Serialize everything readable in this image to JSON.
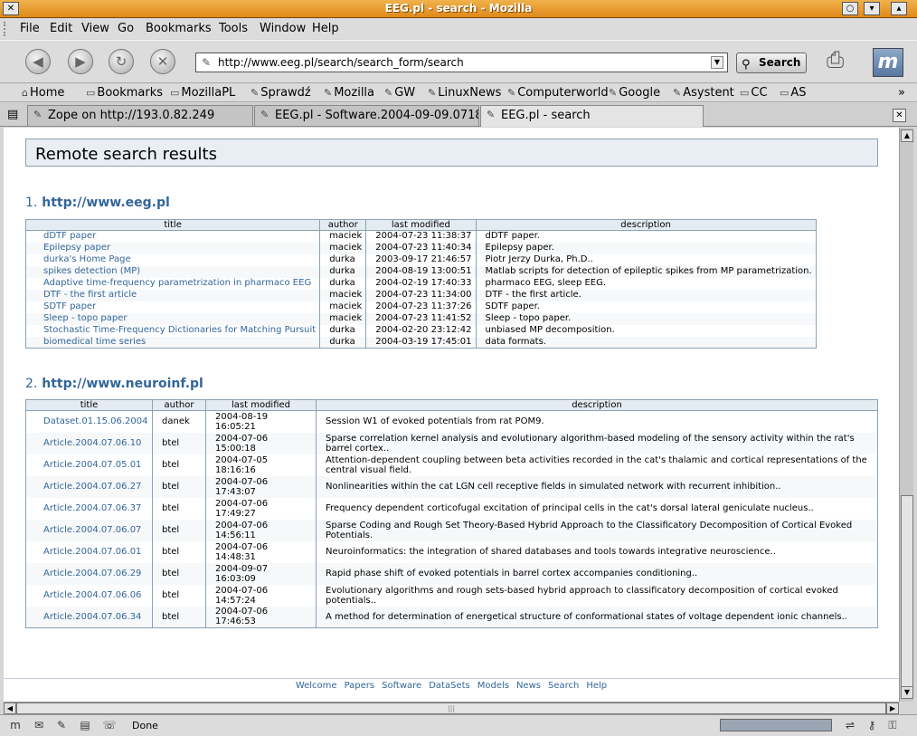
{
  "window": {
    "title": "EEG.pl - search - Mozilla"
  },
  "menubar": [
    "File",
    "Edit",
    "View",
    "Go",
    "Bookmarks",
    "Tools",
    "Window",
    "Help"
  ],
  "navbar": {
    "url": "http://www.eeg.pl/search/search_form/search",
    "search_label": "Search"
  },
  "bookmarks": [
    {
      "label": "Home",
      "icon": "home-icon"
    },
    {
      "label": "Bookmarks",
      "icon": "folder-icon"
    },
    {
      "label": "MozillaPL",
      "icon": "folder-icon"
    },
    {
      "label": "Sprawdź",
      "icon": "bookmark-icon"
    },
    {
      "label": "Mozilla",
      "icon": "bookmark-icon"
    },
    {
      "label": "GW",
      "icon": "bookmark-icon"
    },
    {
      "label": "LinuxNews",
      "icon": "bookmark-icon"
    },
    {
      "label": "Computerworld",
      "icon": "bookmark-icon"
    },
    {
      "label": "Google",
      "icon": "bookmark-icon"
    },
    {
      "label": "Asystent",
      "icon": "bookmark-icon"
    },
    {
      "label": "CC",
      "icon": "folder-icon"
    },
    {
      "label": "AS",
      "icon": "folder-icon"
    }
  ],
  "tabs": [
    {
      "label": "Zope on http://193.0.82.249"
    },
    {
      "label": "EEG.pl - Software.2004-09-09.0718"
    },
    {
      "label": "EEG.pl - search"
    }
  ],
  "page": {
    "heading": "Remote search results",
    "site1": {
      "number": "1.",
      "url": "http://www.eeg.pl",
      "columns": [
        "title",
        "author",
        "last modified",
        "description"
      ],
      "rows": [
        {
          "title": "dDTF paper",
          "author": "maciek",
          "modified": "2004-07-23 11:38:37",
          "description": "dDTF paper."
        },
        {
          "title": "Epilepsy paper",
          "author": "maciek",
          "modified": "2004-07-23 11:40:34",
          "description": "Epilepsy paper."
        },
        {
          "title": "durka's Home Page",
          "author": "durka",
          "modified": "2003-09-17 21:46:57",
          "description": "Piotr Jerzy Durka, Ph.D.."
        },
        {
          "title": "spikes detection (MP)",
          "author": "durka",
          "modified": "2004-08-19 13:00:51",
          "description": "Matlab scripts for detection of epileptic spikes from MP parametrization."
        },
        {
          "title": "Adaptive time-frequency parametrization in pharmaco EEG",
          "author": "durka",
          "modified": "2004-02-19 17:40:33",
          "description": "pharmaco EEG, sleep EEG."
        },
        {
          "title": "DTF - the first article",
          "author": "maciek",
          "modified": "2004-07-23 11:34:00",
          "description": "DTF - the first article."
        },
        {
          "title": "SDTF paper",
          "author": "maciek",
          "modified": "2004-07-23 11:37:26",
          "description": "SDTF paper."
        },
        {
          "title": "Sleep - topo paper",
          "author": "maciek",
          "modified": "2004-07-23 11:41:52",
          "description": "Sleep - topo paper."
        },
        {
          "title": "Stochastic Time-Frequency Dictionaries for Matching Pursuit",
          "author": "durka",
          "modified": "2004-02-20 23:12:42",
          "description": "unbiased MP decomposition."
        },
        {
          "title": "biomedical time series",
          "author": "durka",
          "modified": "2004-03-19 17:45:01",
          "description": "data formats."
        }
      ]
    },
    "site2": {
      "number": "2.",
      "url": "http://www.neuroinf.pl",
      "columns": [
        "title",
        "author",
        "last modified",
        "description"
      ],
      "rows": [
        {
          "title": "Dataset.01.15.06.2004",
          "author": "danek",
          "date": "2004-08-19",
          "time": "16:05:21",
          "description": "Session W1 of evoked potentials from rat POM9."
        },
        {
          "title": "Article.2004.07.06.10",
          "author": "btel",
          "date": "2004-07-06",
          "time": "15:00:18",
          "description": "Sparse correlation kernel analysis and evolutionary algorithm-based modeling of the sensory activity within the rat's barrel cortex.."
        },
        {
          "title": "Article.2004.07.05.01",
          "author": "btel",
          "date": "2004-07-05",
          "time": "18:16:16",
          "description": "Attention-dependent coupling between beta activities recorded in the cat's thalamic and cortical representations of the central visual field."
        },
        {
          "title": "Article.2004.07.06.27",
          "author": "btel",
          "date": "2004-07-06",
          "time": "17:43:07",
          "description": "Nonlinearities within the cat LGN cell receptive fields in simulated network with recurrent inhibition.."
        },
        {
          "title": "Article.2004.07.06.37",
          "author": "btel",
          "date": "2004-07-06",
          "time": "17:49:27",
          "description": "Frequency dependent corticofugal excitation of principal cells in the cat's dorsal lateral geniculate nucleus.."
        },
        {
          "title": "Article.2004.07.06.07",
          "author": "btel",
          "date": "2004-07-06",
          "time": "14:56:11",
          "description": "Sparse Coding and Rough Set Theory-Based Hybrid Approach to the Classificatory Decomposition of Cortical Evoked Potentials."
        },
        {
          "title": "Article.2004.07.06.01",
          "author": "btel",
          "date": "2004-07-06",
          "time": "14:48:31",
          "description": "Neuroinformatics: the integration of shared databases and tools towards integrative neuroscience.."
        },
        {
          "title": "Article.2004.07.06.29",
          "author": "btel",
          "date": "2004-09-07",
          "time": "16:03:09",
          "description": "Rapid phase shift of evoked potentials in barrel cortex accompanies conditioning.."
        },
        {
          "title": "Article.2004.07.06.06",
          "author": "btel",
          "date": "2004-07-06",
          "time": "14:57:24",
          "description": "Evolutionary algorithms and rough sets-based hybrid approach to classificatory decomposition of cortical evoked potentials.."
        },
        {
          "title": "Article.2004.07.06.34",
          "author": "btel",
          "date": "2004-07-06",
          "time": "17:46:53",
          "description": "A method for determination of energetical structure of conformational states of voltage dependent ionic channels.."
        }
      ]
    },
    "footer_links": [
      "Welcome",
      "Papers",
      "Software",
      "DataSets",
      "Models",
      "News",
      "Search",
      "Help"
    ]
  },
  "status": {
    "text": "Done"
  },
  "colors": {
    "link": "#336699",
    "titlebar": "#e08a1a",
    "table_border": "#8aa2b4"
  }
}
